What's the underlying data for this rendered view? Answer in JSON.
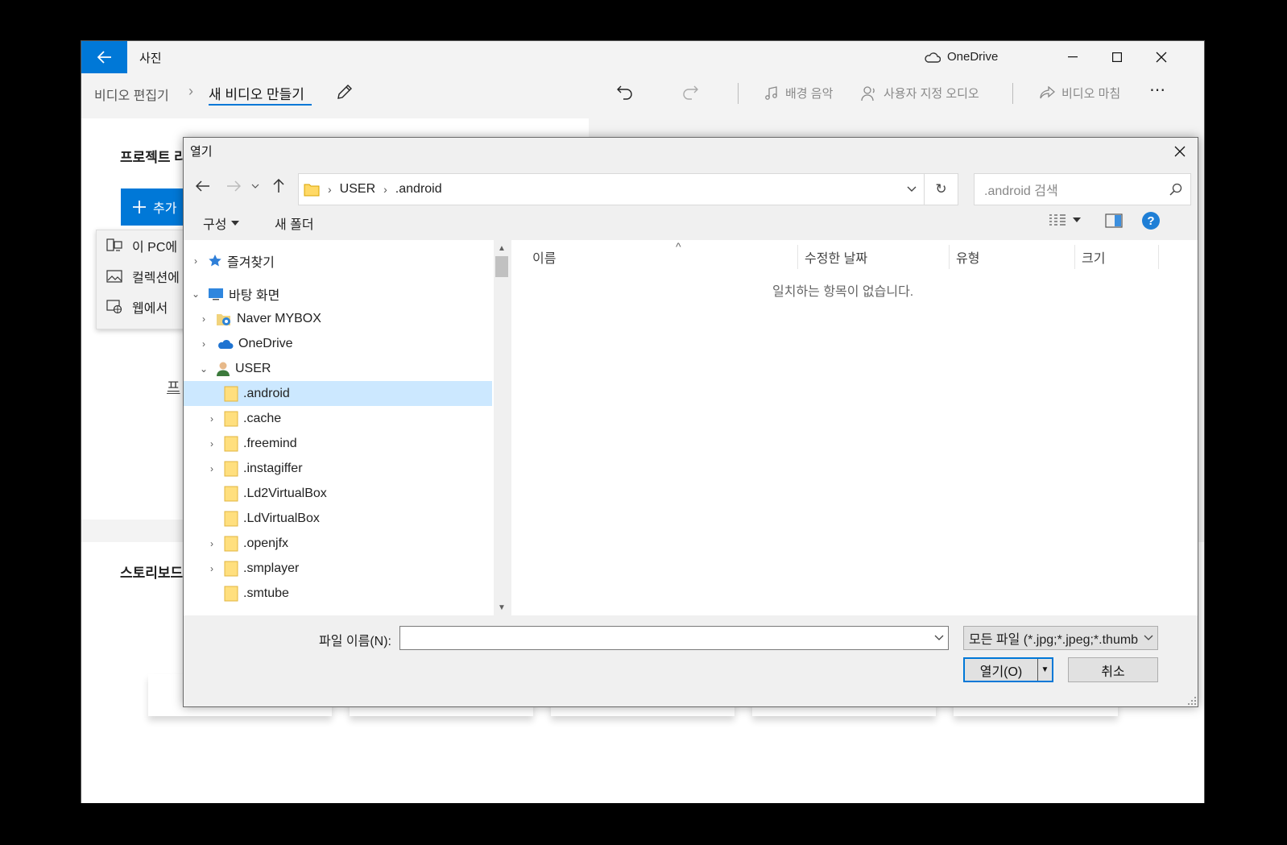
{
  "app": {
    "title": "사진",
    "onedrive_label": "OneDrive"
  },
  "toolbar": {
    "breadcrumb_parent": "비디오 편집기",
    "breadcrumb_current": "새 비디오 만들기",
    "background_music": "배경 음악",
    "custom_audio": "사용자 지정 오디오",
    "finish_video": "비디오 마침"
  },
  "project": {
    "label": "프로젝트 라",
    "add_button": "추가",
    "add_menu": [
      "이 PC에",
      "컬렉션에",
      "웹에서"
    ],
    "link_text": "프"
  },
  "storyboard": {
    "label": "스토리보드"
  },
  "dialog": {
    "title": "열기",
    "address": [
      "USER",
      ".android"
    ],
    "search_placeholder": ".android 검색",
    "organize": "구성",
    "new_folder": "새 폴더",
    "help": "?",
    "tree": [
      {
        "label": "즐겨찾기",
        "icon": "star-icon",
        "expanded": false
      },
      {
        "label": "바탕 화면",
        "icon": "desktop-icon",
        "expanded": true
      },
      {
        "label": "Naver MYBOX",
        "icon": "mybox-icon",
        "expanded": false
      },
      {
        "label": "OneDrive",
        "icon": "cloud-icon",
        "expanded": false
      },
      {
        "label": "USER",
        "icon": "user-icon",
        "expanded": true
      },
      {
        "label": ".android",
        "icon": "folder-icon",
        "selected": true
      },
      {
        "label": ".cache",
        "icon": "folder-icon",
        "expanded": false
      },
      {
        "label": ".freemind",
        "icon": "folder-icon",
        "expanded": false
      },
      {
        "label": ".instagiffer",
        "icon": "folder-icon",
        "expanded": false
      },
      {
        "label": ".Ld2VirtualBox",
        "icon": "folder-icon"
      },
      {
        "label": ".LdVirtualBox",
        "icon": "folder-icon"
      },
      {
        "label": ".openjfx",
        "icon": "folder-icon",
        "expanded": false
      },
      {
        "label": ".smplayer",
        "icon": "folder-icon",
        "expanded": false
      },
      {
        "label": ".smtube",
        "icon": "folder-icon"
      }
    ],
    "columns": [
      "이름",
      "수정한 날짜",
      "유형",
      "크기"
    ],
    "empty_message": "일치하는 항목이 없습니다.",
    "filename_label": "파일 이름(N):",
    "filename_value": "",
    "filetype": "모든 파일 (*.jpg;*.jpeg;*.thumb",
    "open_button": "열기(O)",
    "cancel_button": "취소"
  },
  "colors": {
    "accent": "#0078d7",
    "selection": "#cce8ff"
  }
}
